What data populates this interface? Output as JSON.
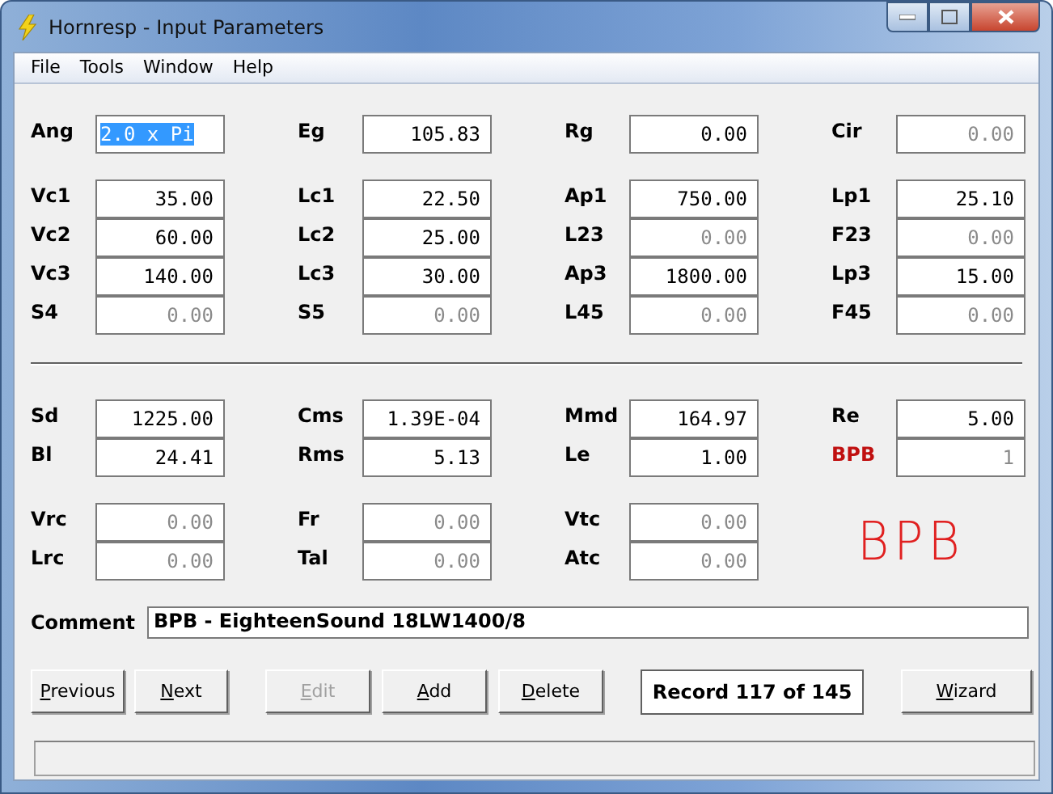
{
  "window": {
    "title": "Hornresp - Input Parameters"
  },
  "menu": [
    "File",
    "Tools",
    "Window",
    "Help"
  ],
  "blocks": [
    {
      "rows": [
        [
          {
            "label": "Ang",
            "value": "2.0 x Pi",
            "dim": false,
            "selected": true,
            "highlight": false
          },
          {
            "label": "Eg",
            "value": "105.83",
            "dim": false,
            "selected": false,
            "highlight": false
          },
          {
            "label": "Rg",
            "value": "0.00",
            "dim": false,
            "selected": false,
            "highlight": false
          },
          {
            "label": "Cir",
            "value": "0.00",
            "dim": true,
            "selected": false,
            "highlight": false
          }
        ]
      ]
    },
    {
      "rows": [
        [
          {
            "label": "Vc1",
            "value": "35.00",
            "dim": false,
            "selected": false,
            "highlight": false
          },
          {
            "label": "Lc1",
            "value": "22.50",
            "dim": false,
            "selected": false,
            "highlight": false
          },
          {
            "label": "Ap1",
            "value": "750.00",
            "dim": false,
            "selected": false,
            "highlight": false
          },
          {
            "label": "Lp1",
            "value": "25.10",
            "dim": false,
            "selected": false,
            "highlight": false
          }
        ],
        [
          {
            "label": "Vc2",
            "value": "60.00",
            "dim": false,
            "selected": false,
            "highlight": false
          },
          {
            "label": "Lc2",
            "value": "25.00",
            "dim": false,
            "selected": false,
            "highlight": false
          },
          {
            "label": "L23",
            "value": "0.00",
            "dim": true,
            "selected": false,
            "highlight": false
          },
          {
            "label": "F23",
            "value": "0.00",
            "dim": true,
            "selected": false,
            "highlight": false
          }
        ],
        [
          {
            "label": "Vc3",
            "value": "140.00",
            "dim": false,
            "selected": false,
            "highlight": false
          },
          {
            "label": "Lc3",
            "value": "30.00",
            "dim": false,
            "selected": false,
            "highlight": false
          },
          {
            "label": "Ap3",
            "value": "1800.00",
            "dim": false,
            "selected": false,
            "highlight": false
          },
          {
            "label": "Lp3",
            "value": "15.00",
            "dim": false,
            "selected": false,
            "highlight": false
          }
        ],
        [
          {
            "label": "S4",
            "value": "0.00",
            "dim": true,
            "selected": false,
            "highlight": false
          },
          {
            "label": "S5",
            "value": "0.00",
            "dim": true,
            "selected": false,
            "highlight": false
          },
          {
            "label": "L45",
            "value": "0.00",
            "dim": true,
            "selected": false,
            "highlight": false
          },
          {
            "label": "F45",
            "value": "0.00",
            "dim": true,
            "selected": false,
            "highlight": false
          }
        ]
      ]
    },
    {
      "rows": [
        [
          {
            "label": "Sd",
            "value": "1225.00",
            "dim": false,
            "selected": false,
            "highlight": false
          },
          {
            "label": "Cms",
            "value": "1.39E-04",
            "dim": false,
            "selected": false,
            "highlight": false
          },
          {
            "label": "Mmd",
            "value": "164.97",
            "dim": false,
            "selected": false,
            "highlight": false
          },
          {
            "label": "Re",
            "value": "5.00",
            "dim": false,
            "selected": false,
            "highlight": false
          }
        ],
        [
          {
            "label": "Bl",
            "value": "24.41",
            "dim": false,
            "selected": false,
            "highlight": false
          },
          {
            "label": "Rms",
            "value": "5.13",
            "dim": false,
            "selected": false,
            "highlight": false
          },
          {
            "label": "Le",
            "value": "1.00",
            "dim": false,
            "selected": false,
            "highlight": false
          },
          {
            "label": "BPB",
            "value": "1",
            "dim": true,
            "selected": false,
            "highlight": true
          }
        ]
      ]
    },
    {
      "rows": [
        [
          {
            "label": "Vrc",
            "value": "0.00",
            "dim": true,
            "selected": false,
            "highlight": false
          },
          {
            "label": "Fr",
            "value": "0.00",
            "dim": true,
            "selected": false,
            "highlight": false
          },
          {
            "label": "Vtc",
            "value": "0.00",
            "dim": true,
            "selected": false,
            "highlight": false
          }
        ],
        [
          {
            "label": "Lrc",
            "value": "0.00",
            "dim": true,
            "selected": false,
            "highlight": false
          },
          {
            "label": "Tal",
            "value": "0.00",
            "dim": true,
            "selected": false,
            "highlight": false
          },
          {
            "label": "Atc",
            "value": "0.00",
            "dim": true,
            "selected": false,
            "highlight": false
          }
        ]
      ],
      "annotation": "BPB"
    }
  ],
  "comment": {
    "label": "Comment",
    "value": "BPB - EighteenSound 18LW1400/8"
  },
  "buttons": [
    {
      "kind": "button",
      "label": "Previous",
      "disabled": false
    },
    {
      "kind": "button",
      "label": "Next",
      "disabled": false
    },
    {
      "kind": "button",
      "label": "Edit",
      "disabled": true
    },
    {
      "kind": "button",
      "label": "Add",
      "disabled": false
    },
    {
      "kind": "button",
      "label": "Delete",
      "disabled": false
    },
    {
      "kind": "record",
      "label": "Record 117 of 145"
    },
    {
      "kind": "button",
      "label": "Wizard",
      "disabled": false
    }
  ]
}
